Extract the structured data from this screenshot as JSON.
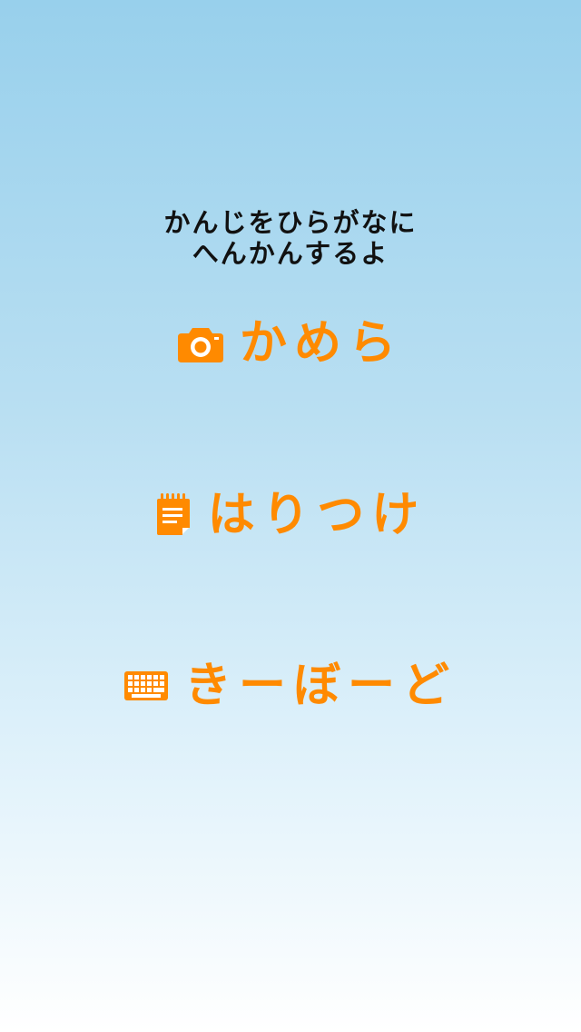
{
  "subtitle": {
    "line1": "かんじをひらがなに",
    "line2": "へんかんするよ"
  },
  "menu": {
    "camera": {
      "label": "かめら",
      "icon": "camera-icon"
    },
    "paste": {
      "label": "はりつけ",
      "icon": "notepad-icon"
    },
    "keyboard": {
      "label": "きーぼーど",
      "icon": "keyboard-icon"
    }
  },
  "colors": {
    "accent": "#ff8a00",
    "text": "#111111",
    "background_top": "#98d0ec",
    "background_bottom": "#ffffff"
  }
}
